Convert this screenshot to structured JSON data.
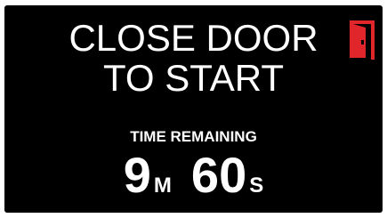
{
  "message": {
    "line1": "CLOSE DOOR",
    "line2": "TO START"
  },
  "icons": {
    "door": "door-open-icon"
  },
  "colors": {
    "background": "#000000",
    "text": "#ffffff",
    "accent": "#e0262a"
  },
  "timer": {
    "label": "TIME REMAINING",
    "minutes": "9",
    "minutes_unit": "M",
    "seconds": "60",
    "seconds_unit": "S"
  }
}
